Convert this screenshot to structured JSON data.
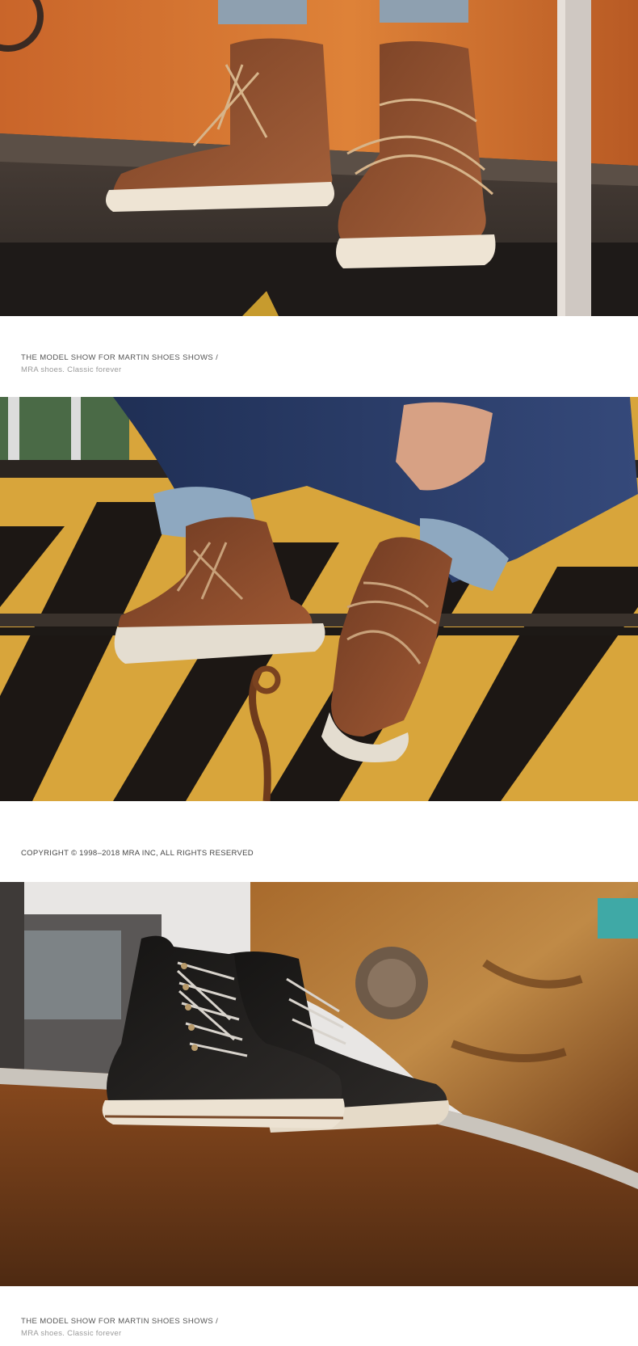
{
  "captions": [
    {
      "title": "THE MODEL SHOW FOR MARTIN SHOES SHOWS  /",
      "subtitle": "MRA shoes. Classic forever"
    },
    {
      "title": "THE MODEL SHOW FOR MARTIN SHOES SHOWS  /",
      "subtitle": "MRA shoes. Classic forever"
    }
  ],
  "copyright": "COPYRIGHT © 1998–2018 MRA INC,  ALL RIGHTS RESERVED",
  "colors": {
    "orange_wall": "#d2712f",
    "brown_leather": "#8a4a26",
    "black_leather": "#1e1c1b",
    "rust": "#8a4a1e",
    "hazard_yellow": "#d9a93a",
    "denim": "#2a3b63"
  }
}
